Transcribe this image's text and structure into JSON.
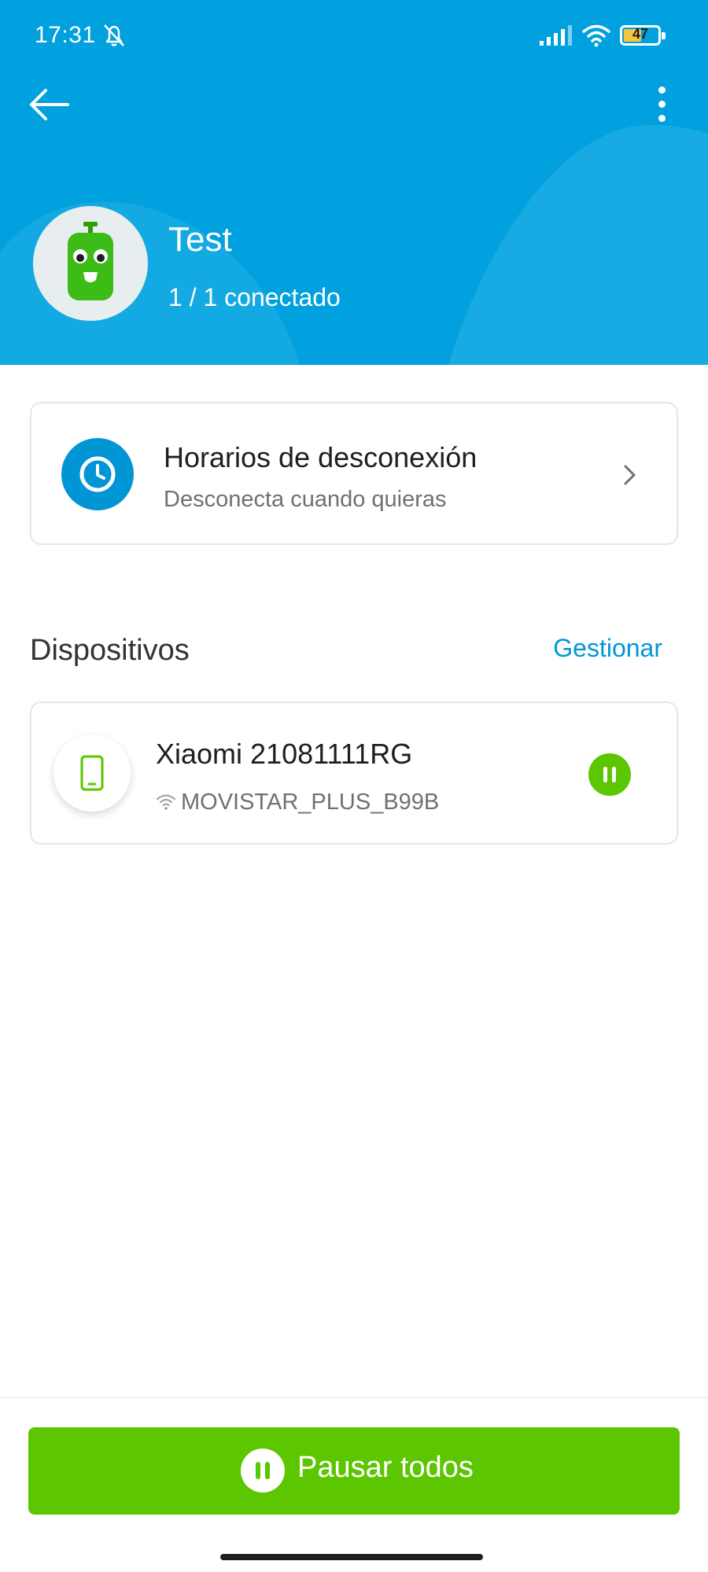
{
  "status_bar": {
    "time": "17:31",
    "battery_level": "47",
    "icons": [
      "bell-off-icon",
      "signal-icon",
      "wifi-icon",
      "battery-icon"
    ]
  },
  "header": {
    "back_icon": "arrow-left-icon",
    "more_icon": "more-vertical-icon",
    "bg_color": "#00a1de"
  },
  "profile": {
    "name": "Test",
    "status": "1 / 1 conectado",
    "avatar_icon": "robot-avatar-icon"
  },
  "schedule": {
    "title": "Horarios de desconexión",
    "subtitle": "Desconecta cuando quieras",
    "icon": "clock-icon",
    "arrow_icon": "chevron-right-icon"
  },
  "devices": {
    "section_title": "Dispositivos",
    "manage_label": "Gestionar",
    "items": [
      {
        "name": "Xiaomi 21081111RG",
        "network": "MOVISTAR_PLUS_B99B",
        "icon": "smartphone-icon",
        "action_icon": "pause-icon"
      }
    ]
  },
  "footer": {
    "pause_all_label": "Pausar todos",
    "accent_color": "#5cc600"
  }
}
